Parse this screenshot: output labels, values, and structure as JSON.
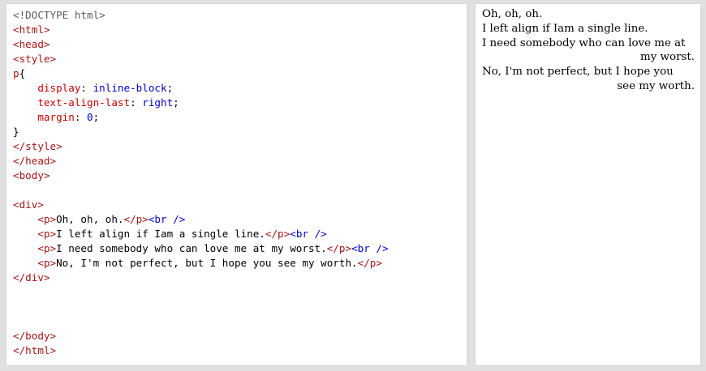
{
  "editor": {
    "lines": [
      [
        {
          "t": "<!DOCTYPE html>",
          "c": "doctype"
        }
      ],
      [
        {
          "t": "<html>",
          "c": "tag"
        }
      ],
      [
        {
          "t": "<head>",
          "c": "tag"
        }
      ],
      [
        {
          "t": "<style>",
          "c": "tag"
        }
      ],
      [
        {
          "t": "p",
          "c": "tag"
        },
        {
          "t": "{",
          "c": "punc"
        }
      ],
      [
        {
          "t": "    ",
          "c": "text"
        },
        {
          "t": "display",
          "c": "prop"
        },
        {
          "t": ": ",
          "c": "punc"
        },
        {
          "t": "inline-block",
          "c": "val"
        },
        {
          "t": ";",
          "c": "punc"
        }
      ],
      [
        {
          "t": "    ",
          "c": "text"
        },
        {
          "t": "text-align-last",
          "c": "prop"
        },
        {
          "t": ": ",
          "c": "punc"
        },
        {
          "t": "right",
          "c": "val"
        },
        {
          "t": ";",
          "c": "punc"
        }
      ],
      [
        {
          "t": "    ",
          "c": "text"
        },
        {
          "t": "margin",
          "c": "prop"
        },
        {
          "t": ": ",
          "c": "punc"
        },
        {
          "t": "0",
          "c": "val"
        },
        {
          "t": ";",
          "c": "punc"
        }
      ],
      [
        {
          "t": "}",
          "c": "punc"
        }
      ],
      [
        {
          "t": "</style>",
          "c": "tag"
        }
      ],
      [
        {
          "t": "</head>",
          "c": "tag"
        }
      ],
      [
        {
          "t": "<body>",
          "c": "tag"
        }
      ],
      [
        {
          "t": "",
          "c": "text"
        }
      ],
      [
        {
          "t": "<div>",
          "c": "tag"
        }
      ],
      [
        {
          "t": "    ",
          "c": "text"
        },
        {
          "t": "<p>",
          "c": "tag"
        },
        {
          "t": "Oh, oh, oh.",
          "c": "text"
        },
        {
          "t": "</p>",
          "c": "tag"
        },
        {
          "t": "<br />",
          "c": "brk"
        }
      ],
      [
        {
          "t": "    ",
          "c": "text"
        },
        {
          "t": "<p>",
          "c": "tag"
        },
        {
          "t": "I left align if Iam a single line.",
          "c": "text"
        },
        {
          "t": "</p>",
          "c": "tag"
        },
        {
          "t": "<br />",
          "c": "brk"
        }
      ],
      [
        {
          "t": "    ",
          "c": "text"
        },
        {
          "t": "<p>",
          "c": "tag"
        },
        {
          "t": "I need somebody who can love me at my worst.",
          "c": "text"
        },
        {
          "t": "</p>",
          "c": "tag"
        },
        {
          "t": "<br />",
          "c": "brk"
        }
      ],
      [
        {
          "t": "    ",
          "c": "text"
        },
        {
          "t": "<p>",
          "c": "tag"
        },
        {
          "t": "No, I'm not perfect, but I hope you see my worth.",
          "c": "text"
        },
        {
          "t": "</p>",
          "c": "tag"
        }
      ],
      [
        {
          "t": "</div>",
          "c": "tag"
        }
      ],
      [
        {
          "t": "",
          "c": "text"
        }
      ],
      [
        {
          "t": "",
          "c": "text"
        }
      ],
      [
        {
          "t": "",
          "c": "text"
        }
      ],
      [
        {
          "t": "</body>",
          "c": "tag"
        }
      ],
      [
        {
          "t": "</html>",
          "c": "tag"
        }
      ]
    ]
  },
  "result": {
    "paragraphs": [
      "Oh, oh, oh.",
      "I left align if Iam a single line.",
      "I need somebody who can love me at my worst.",
      "No, I'm not perfect, but I hope you see my worth."
    ]
  }
}
